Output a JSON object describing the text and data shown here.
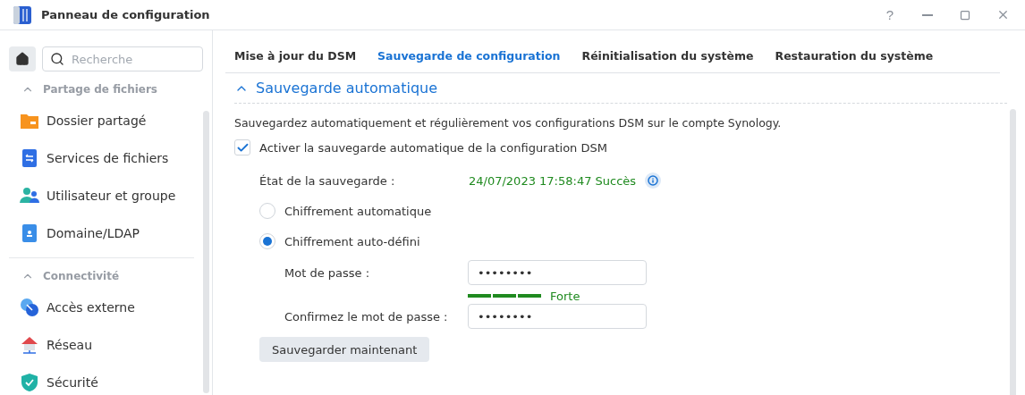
{
  "window": {
    "title": "Panneau de configuration",
    "help": "?"
  },
  "sidebar": {
    "search": {
      "placeholder": "Recherche"
    },
    "groups": [
      {
        "title": "Partage de fichiers",
        "expanded": true,
        "items": [
          {
            "label": "Dossier partagé",
            "kind": "folder"
          },
          {
            "label": "Services de fichiers",
            "kind": "file-services"
          },
          {
            "label": "Utilisateur et groupe",
            "kind": "users"
          },
          {
            "label": "Domaine/LDAP",
            "kind": "domain"
          }
        ]
      },
      {
        "title": "Connectivité",
        "expanded": true,
        "items": [
          {
            "label": "Accès externe",
            "kind": "external"
          },
          {
            "label": "Réseau",
            "kind": "network"
          },
          {
            "label": "Sécurité",
            "kind": "security"
          }
        ]
      }
    ]
  },
  "tabs": [
    {
      "label": "Mise à jour du DSM",
      "selected": false
    },
    {
      "label": "Sauvegarde de configuration",
      "selected": true
    },
    {
      "label": "Réinitialisation du système",
      "selected": false
    },
    {
      "label": "Restauration du système",
      "selected": false
    }
  ],
  "section": {
    "title": "Sauvegarde automatique",
    "expanded": true,
    "description": "Sauvegardez automatiquement et régulièrement vos configurations DSM sur le compte Synology.",
    "enable": {
      "label": "Activer la sauvegarde automatique de la configuration DSM",
      "checked": true
    },
    "status": {
      "label": "État de la sauvegarde :",
      "value": "24/07/2023 17:58:47 Succès"
    },
    "encryption": [
      {
        "label": "Chiffrement automatique",
        "selected": false
      },
      {
        "label": "Chiffrement auto-défini",
        "selected": true
      }
    ],
    "password": {
      "label": "Mot de passe :",
      "value": "••••••••",
      "strength": {
        "label": "Forte"
      }
    },
    "confirm": {
      "label": "Confirmez le mot de passe :",
      "value": "••••••••"
    },
    "button": "Sauvegarder maintenant"
  }
}
